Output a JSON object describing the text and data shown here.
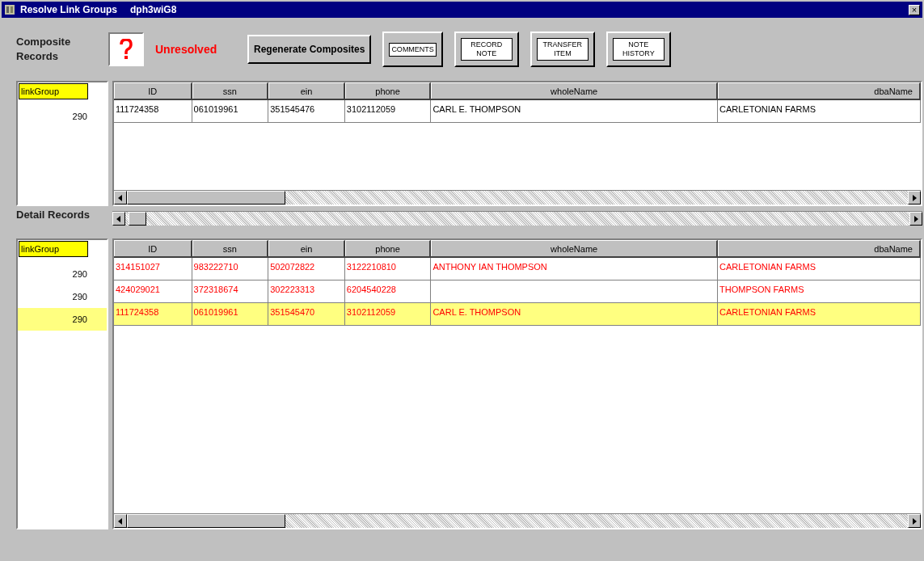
{
  "window": {
    "title": "Resolve Link Groups",
    "subtitle": "dph3wiG8",
    "close": "×"
  },
  "composite_label": "Composite Records",
  "status": "Unresolved",
  "buttons": [
    {
      "kind": "text",
      "label": "Regenerate Composites"
    },
    {
      "kind": "image",
      "label": "COMMENTS"
    },
    {
      "kind": "image",
      "label": "RECORD NOTE"
    },
    {
      "kind": "image",
      "label": "TRANSFER ITEM"
    },
    {
      "kind": "image",
      "label": "NOTE HISTORY"
    }
  ],
  "composite": {
    "link_header": "linkGroup",
    "columns": [
      "ID",
      "ssn",
      "ein",
      "phone",
      "wholeName",
      "dbaName"
    ],
    "rows": [
      {
        "link": "290",
        "cells": [
          "111724358",
          "061019961",
          "351545476",
          "3102112059",
          "CARL E. THOMPSON",
          "CARLETONIAN FARMS"
        ]
      }
    ]
  },
  "detail_label": "Detail Records",
  "detail": {
    "link_header": "linkGroup",
    "columns": [
      "ID",
      "ssn",
      "ein",
      "phone",
      "wholeName",
      "dbaName"
    ],
    "rows": [
      {
        "link": "290",
        "selected": false,
        "cells": [
          "314151027",
          "983222710",
          "502072822",
          "3122210810",
          "ANTHONY IAN THOMPSON",
          "CARLETONIAN FARMS"
        ]
      },
      {
        "link": "290",
        "selected": false,
        "cells": [
          "424029021",
          "372318674",
          "302223313",
          "6204540228",
          "",
          "THOMPSON FARMS"
        ]
      },
      {
        "link": "290",
        "selected": true,
        "cells": [
          "111724358",
          "061019961",
          "351545470",
          "3102112059",
          "CARL E. THOMPSON",
          "CARLETONIAN FARMS"
        ]
      }
    ]
  }
}
